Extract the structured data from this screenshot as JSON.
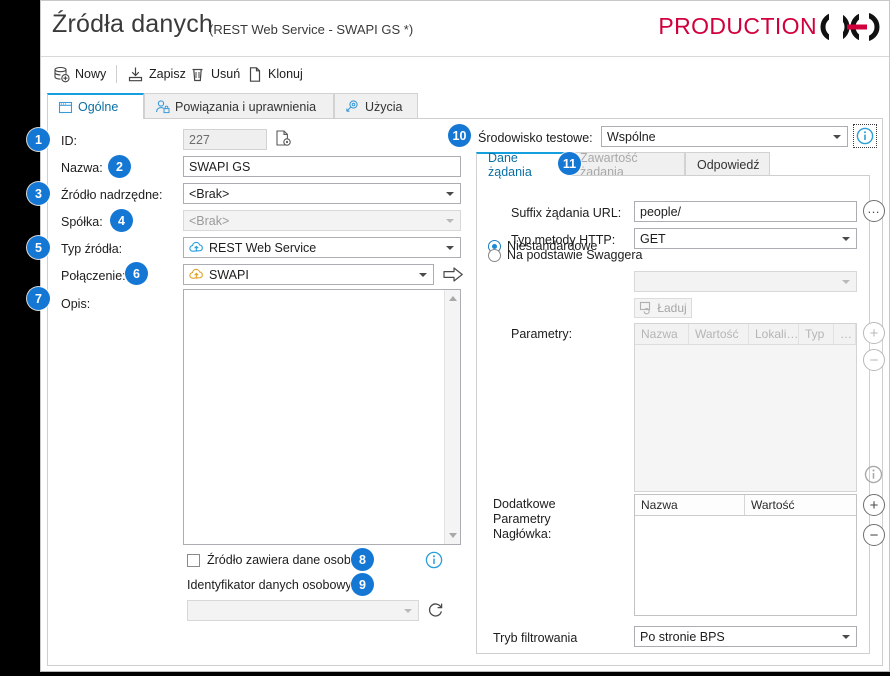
{
  "window": {
    "title": "Źródła danych",
    "subtitle": "(REST Web Service - SWAPI GS *)",
    "brand": "PRODUCTION",
    "brand_color": "#d1003c",
    "accent_color": "#14a0de",
    "badge_color": "#1477d4"
  },
  "toolbar": {
    "items": [
      {
        "label": "Nowy",
        "icon": "database-add-icon"
      },
      {
        "label": "Zapisz",
        "icon": "save-icon"
      },
      {
        "label": "Usuń",
        "icon": "trash-icon"
      },
      {
        "label": "Klonuj",
        "icon": "copy-page-icon"
      }
    ]
  },
  "tabs": [
    {
      "label": "Ogólne",
      "icon": "window-icon",
      "active": true
    },
    {
      "label": "Powiązania i uprawnienia",
      "icon": "user-lock-icon",
      "active": false
    },
    {
      "label": "Użycia",
      "icon": "usage-icon",
      "active": false
    }
  ],
  "left_form": {
    "id": {
      "label": "ID:",
      "value": "227",
      "disabled": true,
      "icon": "page-gear-icon"
    },
    "name": {
      "label": "Nazwa:",
      "value": "SWAPI GS"
    },
    "parent_source": {
      "label": "Źródło nadrzędne:",
      "value": "<Brak>"
    },
    "company": {
      "label": "Spółka:",
      "value": "<Brak>",
      "disabled": true
    },
    "source_type": {
      "label": "Typ źródła:",
      "value": "REST Web Service",
      "icon": "cloud-blue-icon"
    },
    "connection": {
      "label": "Połączenie:",
      "value": "SWAPI",
      "icon": "cloud-orange-icon",
      "go_icon": "arrow-right-icon"
    },
    "description": {
      "label": "Opis:",
      "value": ""
    },
    "personal_data_checkbox": {
      "label": "Źródło zawiera dane osobowe",
      "checked": false,
      "info_icon": "info-icon"
    },
    "personal_data_id": {
      "label": "Identyfikator danych osobowych:",
      "value": "",
      "disabled": true,
      "refresh_icon": "refresh-icon"
    }
  },
  "right_panel": {
    "test_env": {
      "label": "Środowisko testowe:",
      "value": "Wspólne",
      "info_icon": "info-icon"
    },
    "tabs": [
      {
        "label": "Dane żądania",
        "active": true,
        "disabled": false
      },
      {
        "label": "Zawartość żądania",
        "active": false,
        "disabled": true
      },
      {
        "label": "Odpowiedź",
        "active": false,
        "disabled": false
      }
    ],
    "mode_custom": {
      "label": "Niestandardowe",
      "selected": true
    },
    "url_suffix": {
      "label": "Suffix żądania URL:",
      "value": "people/",
      "browse_label": "…"
    },
    "http_method": {
      "label": "Typ metody HTTP:",
      "value": "GET"
    },
    "mode_swagger": {
      "label": "Na podstawie Swaggera",
      "selected": false
    },
    "swagger_combo": {
      "value": "",
      "disabled": true
    },
    "load_button": {
      "label": "Ładuj",
      "disabled": true,
      "icon": "load-icon"
    },
    "parameters": {
      "label": "Parametry:",
      "disabled": true,
      "columns": [
        "Nazwa",
        "Wartość",
        "Lokali…",
        "Typ",
        "…"
      ],
      "rows": [],
      "add_label": "+",
      "remove_label": "−",
      "info_icon": "info-icon"
    },
    "extra_headers": {
      "label": "Dodatkowe\nParametry\nNagłówka:",
      "label_lines": [
        "Dodatkowe",
        "Parametry",
        "Nagłówka:"
      ],
      "columns": [
        "Nazwa",
        "Wartość"
      ],
      "rows": [],
      "add_label": "+",
      "remove_label": "−"
    },
    "filter_mode": {
      "label": "Tryb filtrowania",
      "value": "Po stronie BPS"
    }
  },
  "callouts": [
    {
      "n": "1"
    },
    {
      "n": "2"
    },
    {
      "n": "3"
    },
    {
      "n": "4"
    },
    {
      "n": "5"
    },
    {
      "n": "6"
    },
    {
      "n": "7"
    },
    {
      "n": "8"
    },
    {
      "n": "9"
    },
    {
      "n": "10"
    },
    {
      "n": "11"
    }
  ]
}
